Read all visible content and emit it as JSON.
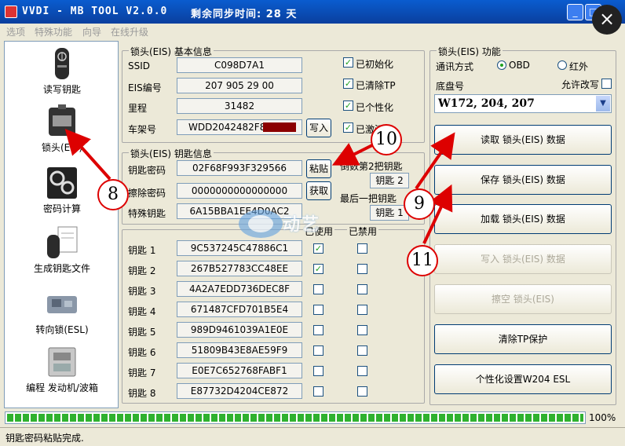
{
  "window": {
    "title": "VVDI - MB TOOL V2.0.0",
    "sync_time": "剩余同步时间: 28 天",
    "minimize": "_",
    "maximize": "□",
    "close": "×"
  },
  "menu": [
    "选项",
    "特殊功能",
    "向导",
    "在线升级"
  ],
  "nav": [
    {
      "label": "读写钥匙",
      "icon": "car-key-icon"
    },
    {
      "label": "锁头(EIS)",
      "icon": "eis-lock-icon"
    },
    {
      "label": "密码计算",
      "icon": "gears-icon"
    },
    {
      "label": "生成钥匙文件",
      "icon": "key-file-icon"
    },
    {
      "label": "转向锁(ESL)",
      "icon": "steering-lock-icon"
    },
    {
      "label": "编程 发动机/波箱",
      "icon": "ecu-icon"
    }
  ],
  "eis_info": {
    "title": "锁头(EIS) 基本信息",
    "ssid_label": "SSID",
    "ssid": "C098D7A1",
    "eis_no_label": "EIS编号",
    "eis_no": "207 905 29 00",
    "mileage_label": "里程",
    "mileage": "31482",
    "vin_label": "车架号",
    "vin": "WDD2042482F8",
    "write_button": "写入",
    "flags": [
      {
        "label": "已初始化",
        "checked": true
      },
      {
        "label": "已清除TP",
        "checked": true
      },
      {
        "label": "已个性化",
        "checked": true
      },
      {
        "label": "已激活",
        "checked": true
      }
    ]
  },
  "key_info": {
    "title": "锁头(EIS) 钥匙信息",
    "key_password_label": "钥匙密码",
    "key_password": "02F68F993F329566",
    "paste_button": "粘贴",
    "erase_password_label": "擦除密码",
    "erase_password": "0000000000000000",
    "get_button": "获取",
    "special_key_label": "特殊钥匙",
    "special_key": "6A15BBA1EE4D0AC2",
    "second_key_label": "倒数第2把钥匙",
    "second_key_value": "钥匙 2",
    "last_key_label": "最后一把钥匙",
    "last_key_value": "钥匙 1"
  },
  "keys_table": {
    "used_header": "已使用",
    "disabled_header": "已禁用",
    "rows": [
      {
        "label": "钥匙 1",
        "value": "9C537245C47886C1",
        "used": true,
        "disabled": false
      },
      {
        "label": "钥匙 2",
        "value": "267B527783CC48EE",
        "used": true,
        "disabled": false
      },
      {
        "label": "钥匙 3",
        "value": "4A2A7EDD736DEC8F",
        "used": false,
        "disabled": false
      },
      {
        "label": "钥匙 4",
        "value": "671487CFD701B5E4",
        "used": false,
        "disabled": false
      },
      {
        "label": "钥匙 5",
        "value": "989D9461039A1E0E",
        "used": false,
        "disabled": false
      },
      {
        "label": "钥匙 6",
        "value": "51809B43E8AE59F9",
        "used": false,
        "disabled": false
      },
      {
        "label": "钥匙 7",
        "value": "E0E7C652768FABF1",
        "used": false,
        "disabled": false
      },
      {
        "label": "钥匙 8",
        "value": "E87732D4204CE872",
        "used": false,
        "disabled": false
      }
    ]
  },
  "eis_function": {
    "title": "锁头(EIS) 功能",
    "comm_label": "通讯方式",
    "obd_label": "OBD",
    "ir_label": "红外",
    "chassis_label": "底盘号",
    "allow_rewrite_label": "允许改写",
    "chassis_value": "W172, 204, 207",
    "buttons": [
      {
        "label": "读取 锁头(EIS) 数据",
        "enabled": true
      },
      {
        "label": "保存 锁头(EIS) 数据",
        "enabled": true
      },
      {
        "label": "加载 锁头(EIS) 数据",
        "enabled": true
      },
      {
        "label": "写入 锁头(EIS) 数据",
        "enabled": false
      },
      {
        "label": "擦空 锁头(EIS)",
        "enabled": false
      },
      {
        "label": "清除TP保护",
        "enabled": true
      },
      {
        "label": "个性化设置W204 ESL",
        "enabled": true
      }
    ]
  },
  "progress": {
    "value": 100,
    "text": "100%"
  },
  "status": "钥匙密码粘贴完成.",
  "annotations": [
    "8",
    "9",
    "10",
    "11"
  ],
  "colors": {
    "title_bar": "#0a4fb8",
    "accent_green": "#21a121",
    "annotation_red": "#d00000"
  }
}
